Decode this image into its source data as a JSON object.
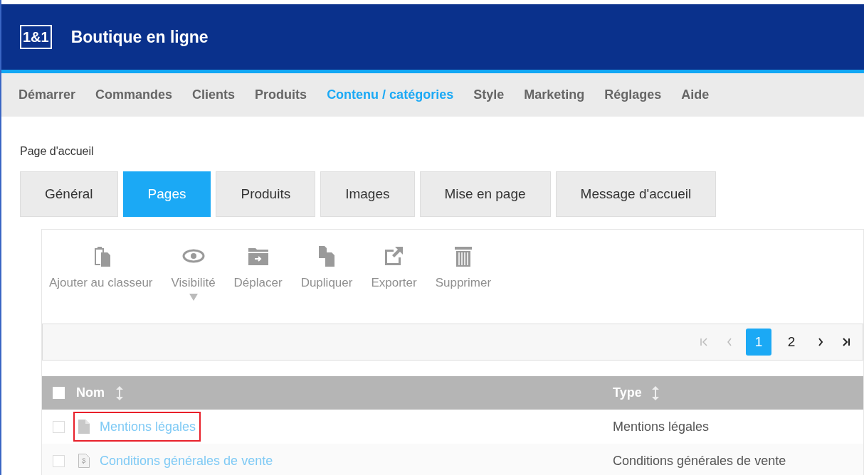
{
  "header": {
    "logo": "1&1",
    "title": "Boutique en ligne"
  },
  "nav": [
    {
      "label": "Démarrer",
      "selected": false
    },
    {
      "label": "Commandes",
      "selected": false
    },
    {
      "label": "Clients",
      "selected": false
    },
    {
      "label": "Produits",
      "selected": false
    },
    {
      "label": "Contenu / catégories",
      "selected": true
    },
    {
      "label": "Style",
      "selected": false
    },
    {
      "label": "Marketing",
      "selected": false
    },
    {
      "label": "Réglages",
      "selected": false
    },
    {
      "label": "Aide",
      "selected": false
    }
  ],
  "breadcrumb": "Page d'accueil",
  "tabs": [
    {
      "label": "Général",
      "selected": false
    },
    {
      "label": "Pages",
      "selected": true
    },
    {
      "label": "Produits",
      "selected": false
    },
    {
      "label": "Images",
      "selected": false
    },
    {
      "label": "Mise en page",
      "selected": false
    },
    {
      "label": "Message d'accueil",
      "selected": false
    }
  ],
  "toolbar": [
    {
      "kind": "clipboard",
      "label": "Ajouter au classeur",
      "disabled": true,
      "dropdown": false
    },
    {
      "kind": "eye",
      "label": "Visibilité",
      "disabled": true,
      "dropdown": true
    },
    {
      "kind": "folder",
      "label": "Déplacer",
      "disabled": true,
      "dropdown": false
    },
    {
      "kind": "copy",
      "label": "Dupliquer",
      "disabled": true,
      "dropdown": false
    },
    {
      "kind": "export",
      "label": "Exporter",
      "disabled": true,
      "dropdown": false
    },
    {
      "kind": "trash",
      "label": "Supprimer",
      "disabled": true,
      "dropdown": false
    }
  ],
  "pagination": {
    "first": {
      "disabled": true
    },
    "prev": {
      "disabled": true
    },
    "pages": [
      {
        "label": "1",
        "selected": true
      },
      {
        "label": "2",
        "selected": false
      }
    ],
    "next": {
      "disabled": false
    },
    "last": {
      "disabled": false
    }
  },
  "table": {
    "select_all": {
      "checked": false
    },
    "columns": [
      "Nom",
      "Type"
    ],
    "rows": [
      {
        "kind": "page",
        "name": "Mentions légales",
        "type": "Mentions légales",
        "checked": false,
        "highlighted": true
      },
      {
        "kind": "legal",
        "name": "Conditions générales de vente",
        "type": "Conditions générales de vente",
        "checked": false,
        "highlighted": false
      }
    ]
  }
}
